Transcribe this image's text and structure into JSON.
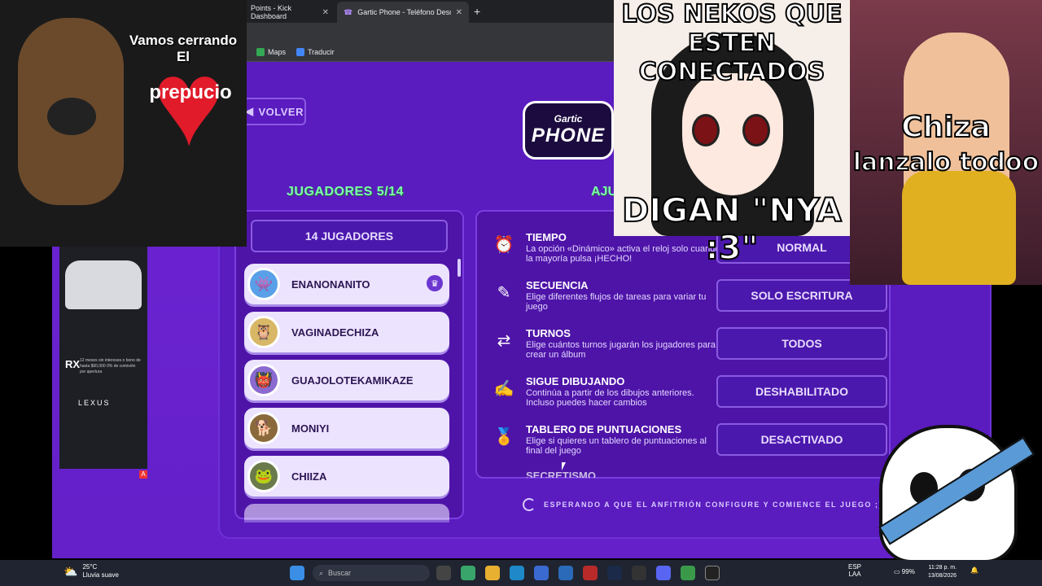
{
  "browser": {
    "tabs": [
      {
        "label": "Points - Kick Dashboard"
      },
      {
        "label": "Gartic Phone - Teléfono Descomp"
      }
    ],
    "bookmarks": [
      {
        "label": "Maps"
      },
      {
        "label": "Traducir"
      }
    ]
  },
  "game": {
    "back_label": "VOLVER",
    "logo": {
      "line1": "Gartic",
      "line2": "PHONE"
    },
    "players_heading": "JUGADORES 5/14",
    "settings_heading": "AJU",
    "players_count_button": "14 JUGADORES",
    "players": [
      {
        "name": "ENANONANITO",
        "avatar": "blue-monster-icon",
        "host": true
      },
      {
        "name": "VAGINADECHIZA",
        "avatar": "owl-icon",
        "host": false
      },
      {
        "name": "GUAJOLOTEKAMIKAZE",
        "avatar": "green-monster-icon",
        "host": false
      },
      {
        "name": "MONIYI",
        "avatar": "dog-icon",
        "host": false
      },
      {
        "name": "CHIIZA",
        "avatar": "creature-icon",
        "host": false
      }
    ],
    "settings": [
      {
        "title": "TIEMPO",
        "desc": "La opción «Dinámico» activa el reloj solo cuando la mayoría pulsa ¡HECHO!",
        "value": "NORMAL",
        "icon": "clock-icon"
      },
      {
        "title": "SECUENCIA",
        "desc": "Elige diferentes flujos de tareas para variar tu juego",
        "value": "SOLO ESCRITURA",
        "icon": "sequence-icon"
      },
      {
        "title": "TURNOS",
        "desc": "Elige cuántos turnos jugarán los jugadores para crear un álbum",
        "value": "TODOS",
        "icon": "turns-icon"
      },
      {
        "title": "SIGUE DIBUJANDO",
        "desc": "Continúa a partir de los dibujos anteriores. Incluso puedes hacer cambios",
        "value": "DESHABILITADO",
        "icon": "draw-icon"
      },
      {
        "title": "TABLERO DE PUNTUACIONES",
        "desc": "Elige si quieres un tablero de puntuaciones al final del juego",
        "value": "DESACTIVADO",
        "icon": "medal-icon"
      },
      {
        "title": "SECRETISMO",
        "desc": "",
        "value": "",
        "icon": "secret-icon"
      }
    ],
    "waiting_text": "ESPERANDO A QUE EL ANFITRIÓN CONFIGURE Y COMIENCE EL JUEGO ;)"
  },
  "overlays": {
    "dog_text": "Vamos cerrando El",
    "heart_text": "prepucio",
    "neko_line1": "LOS NEKOS QUE",
    "neko_line2": "ESTEN CONECTADOS",
    "neko_line3": "DIGAN \"NYA :3\"",
    "cat_line1": "Chiza",
    "cat_line2": "lanzalo todoo"
  },
  "ad": {
    "model": "RX",
    "text": "12 meses sin intereses o bono de hasta $60,000 0% de comisión por apertura",
    "brand": "LEXUS",
    "badge": "A"
  },
  "taskbar": {
    "temp": "25°C",
    "weather": "Lluvia suave",
    "search_placeholder": "Buscar",
    "lang1": "ESP",
    "lang2": "LAA",
    "battery": "99%",
    "time": "11:28 p. m.",
    "date": "13/08/2026"
  }
}
